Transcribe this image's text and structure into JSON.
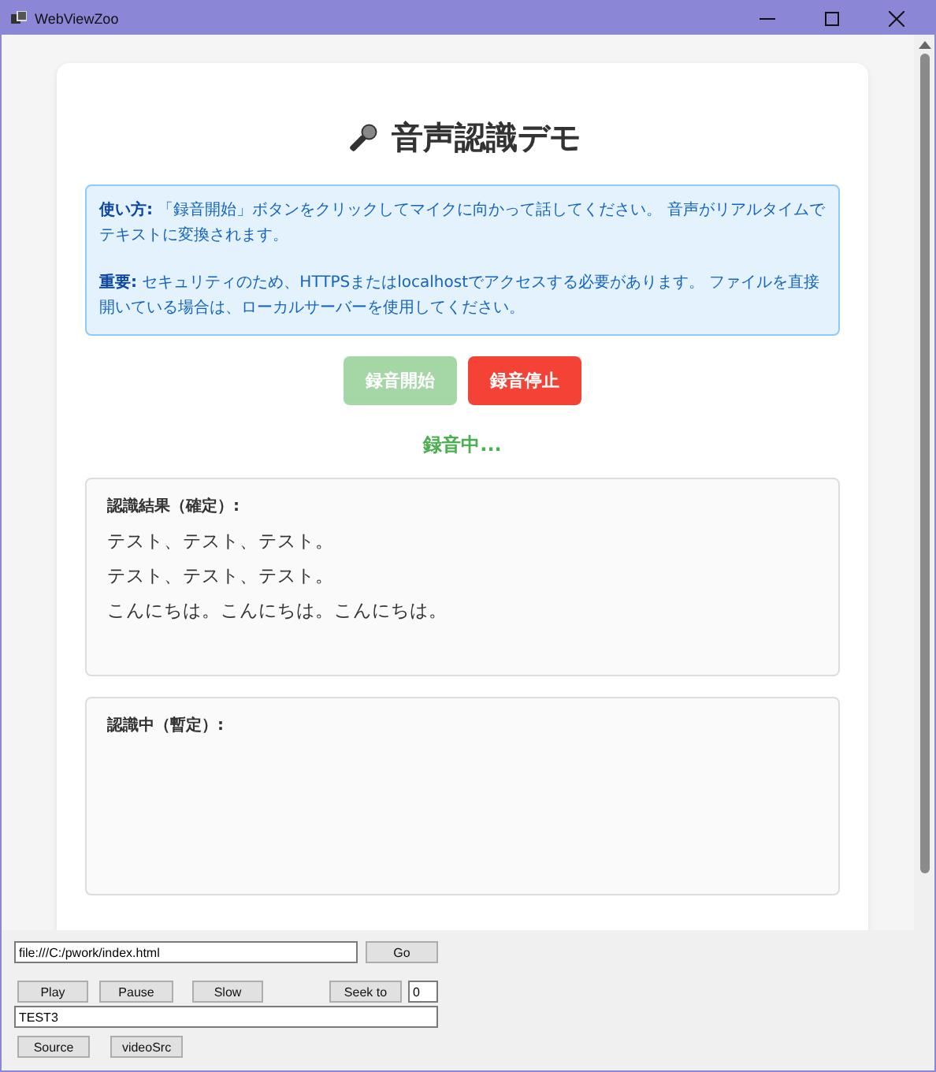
{
  "window": {
    "title": "WebViewZoo"
  },
  "page": {
    "heading": "音声認識デモ",
    "info": [
      "**使い方:** 「録音開始」ボタンをクリックしてマイクに向かって話してください。 音声がリアルタイムでテキストに変換されます。",
      "**重要:** セキュリティのため、HTTPSまたはlocalhostでアクセスする必要があります。 ファイルを直接開いている場合は、ローカルサーバーを使用してください。"
    ],
    "buttons": [
      {
        "label": "録音開始",
        "kind": "start",
        "disabled": true
      },
      {
        "label": "録音停止",
        "kind": "stop",
        "disabled": false
      }
    ],
    "status": "録音中...",
    "panels": [
      {
        "label": "認識結果（確定）:",
        "lines": [
          "テスト、テスト、テスト。",
          "テスト、テスト、テスト。",
          "こんにちは。こんにちは。こんにちは。"
        ]
      },
      {
        "label": "認識中（暫定）:"
      }
    ]
  },
  "controls": {
    "url": "file:///C:/pwork/index.html",
    "go": "Go",
    "media_buttons": [
      "Play",
      "Pause",
      "Slow"
    ],
    "seek": "Seek to",
    "seek_value": "0",
    "text_field": "TEST3",
    "source_buttons": [
      "Source",
      "videoSrc"
    ]
  }
}
